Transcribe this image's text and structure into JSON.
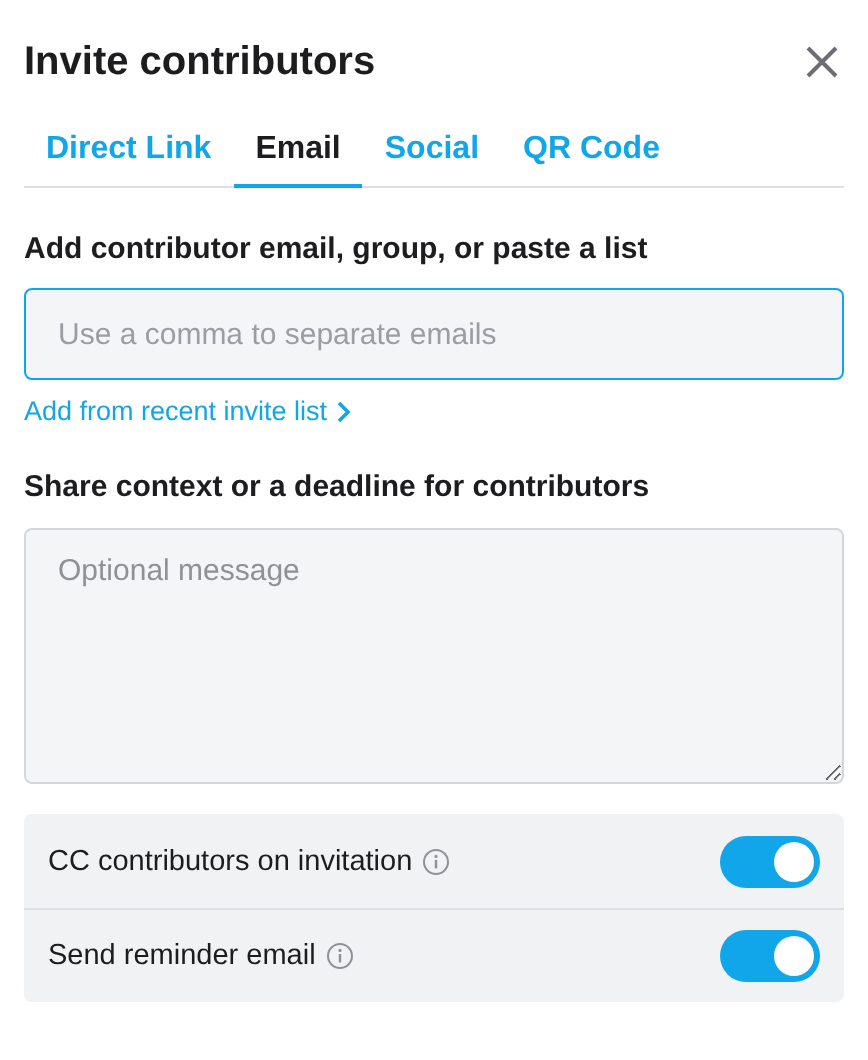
{
  "dialog": {
    "title": "Invite contributors"
  },
  "tabs": [
    {
      "label": "Direct Link",
      "selected": false
    },
    {
      "label": "Email",
      "selected": true
    },
    {
      "label": "Social",
      "selected": false
    },
    {
      "label": "QR Code",
      "selected": false
    }
  ],
  "email_field": {
    "label": "Add contributor email, group, or paste a list",
    "placeholder": "Use a comma to separate emails"
  },
  "recent_link": "Add from recent invite list",
  "message_field": {
    "label": "Share context or a deadline for contributors",
    "placeholder": "Optional message"
  },
  "options": [
    {
      "label": "CC contributors on invitation",
      "on": true
    },
    {
      "label": "Send reminder email",
      "on": true
    }
  ]
}
